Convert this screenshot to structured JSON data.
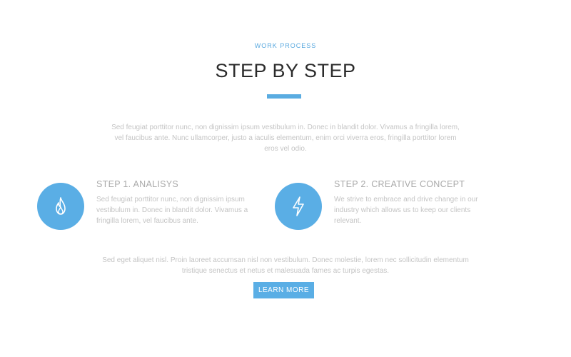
{
  "section": {
    "eyebrow": "WORK PROCESS",
    "title": "STEP BY STEP",
    "intro_line1": "Sed feugiat porttitor nunc, non dignissim ipsum vestibulum in. Donec in blandit dolor. Vivamus a fringilla lorem,",
    "intro_line2": "vel faucibus ante. Nunc ullamcorper, justo a iaculis elementum, enim orci viverra eros, fringilla porttitor lorem",
    "intro_line3": "eros vel odio.",
    "accent_color": "#5aaee5"
  },
  "steps": [
    {
      "title": "STEP 1. ANALISYS",
      "icon": "flame-icon",
      "desc_line1": "Sed feugiat porttitor nunc, non dignissim ipsum",
      "desc_line2": "vestibulum in. Donec in blandit dolor. Vivamus a",
      "desc_line3": "fringilla lorem, vel faucibus ante."
    },
    {
      "title": "STEP 2. CREATIVE CONCEPT",
      "icon": "lightning-bolt-icon",
      "desc_line1": "We strive to embrace and drive change in our",
      "desc_line2": "industry which allows us to keep our clients",
      "desc_line3": "relevant."
    }
  ],
  "outro": {
    "line1": "Sed eget aliquet nisl. Proin laoreet accumsan nisl non vestibulum. Donec molestie, lorem nec sollicitudin elementum",
    "line2": "tristique senectus et netus et malesuada fames ac turpis egestas.",
    "cta_label": "LEARN MORE"
  }
}
